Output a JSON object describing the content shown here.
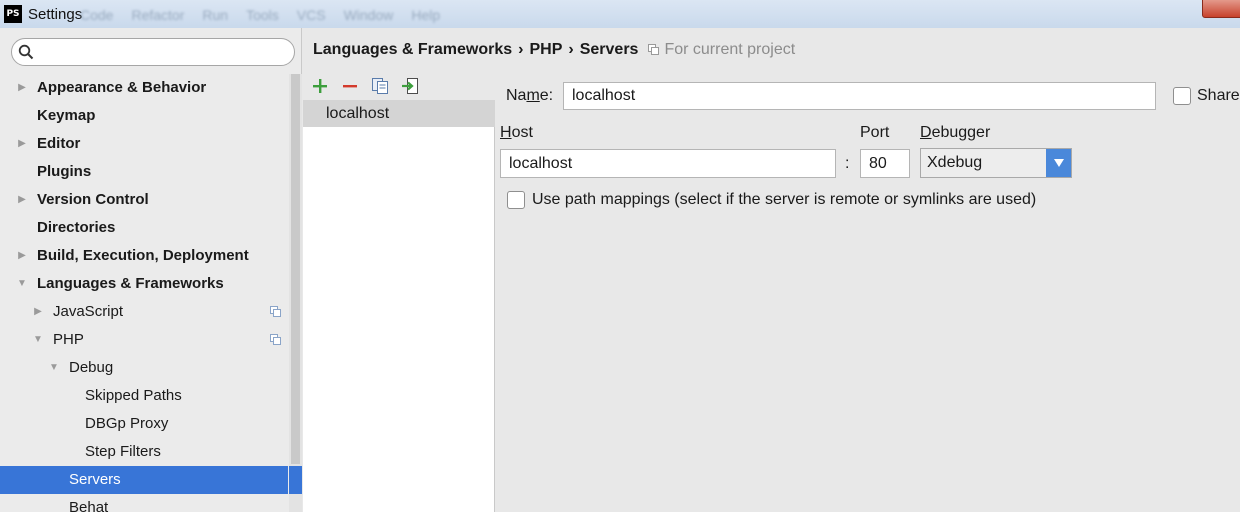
{
  "window": {
    "title": "Settings",
    "logo_text": "PS",
    "ghost_menu": [
      "Code",
      "Refactor",
      "Run",
      "Tools",
      "VCS",
      "Window",
      "Help"
    ]
  },
  "search": {
    "placeholder": "",
    "value": ""
  },
  "tree": {
    "appearance": "Appearance & Behavior",
    "keymap": "Keymap",
    "editor": "Editor",
    "plugins": "Plugins",
    "version_control": "Version Control",
    "directories": "Directories",
    "build": "Build, Execution, Deployment",
    "languages": "Languages & Frameworks",
    "javascript": "JavaScript",
    "php": "PHP",
    "debug": "Debug",
    "skipped_paths": "Skipped Paths",
    "dbgp_proxy": "DBGp Proxy",
    "step_filters": "Step Filters",
    "servers": "Servers",
    "behat": "Behat"
  },
  "breadcrumb": {
    "part1": "Languages & Frameworks",
    "part2": "PHP",
    "part3": "Servers",
    "separator": "›",
    "scope": "For current project"
  },
  "server_list": {
    "items": [
      "localhost"
    ]
  },
  "form": {
    "name_label_prefix": "Na",
    "name_label_underlined": "m",
    "name_label_suffix": "e:",
    "name_value": "localhost",
    "shared_label": "Share",
    "host_label_underlined": "H",
    "host_label_rest": "ost",
    "host_value": "localhost",
    "colon": ":",
    "port_label": "Port",
    "port_value": "80",
    "debugger_label_underlined": "D",
    "debugger_label_rest": "ebugger",
    "debugger_value": "Xdebug",
    "path_mappings_label": "Use path mappings (select if the server is remote or symlinks are used)",
    "path_mappings_checked": false
  },
  "colors": {
    "selection": "#3875d7",
    "add_icon": "#3c9e3c",
    "remove_icon": "#d33a2c",
    "dropdown": "#4a88da"
  }
}
